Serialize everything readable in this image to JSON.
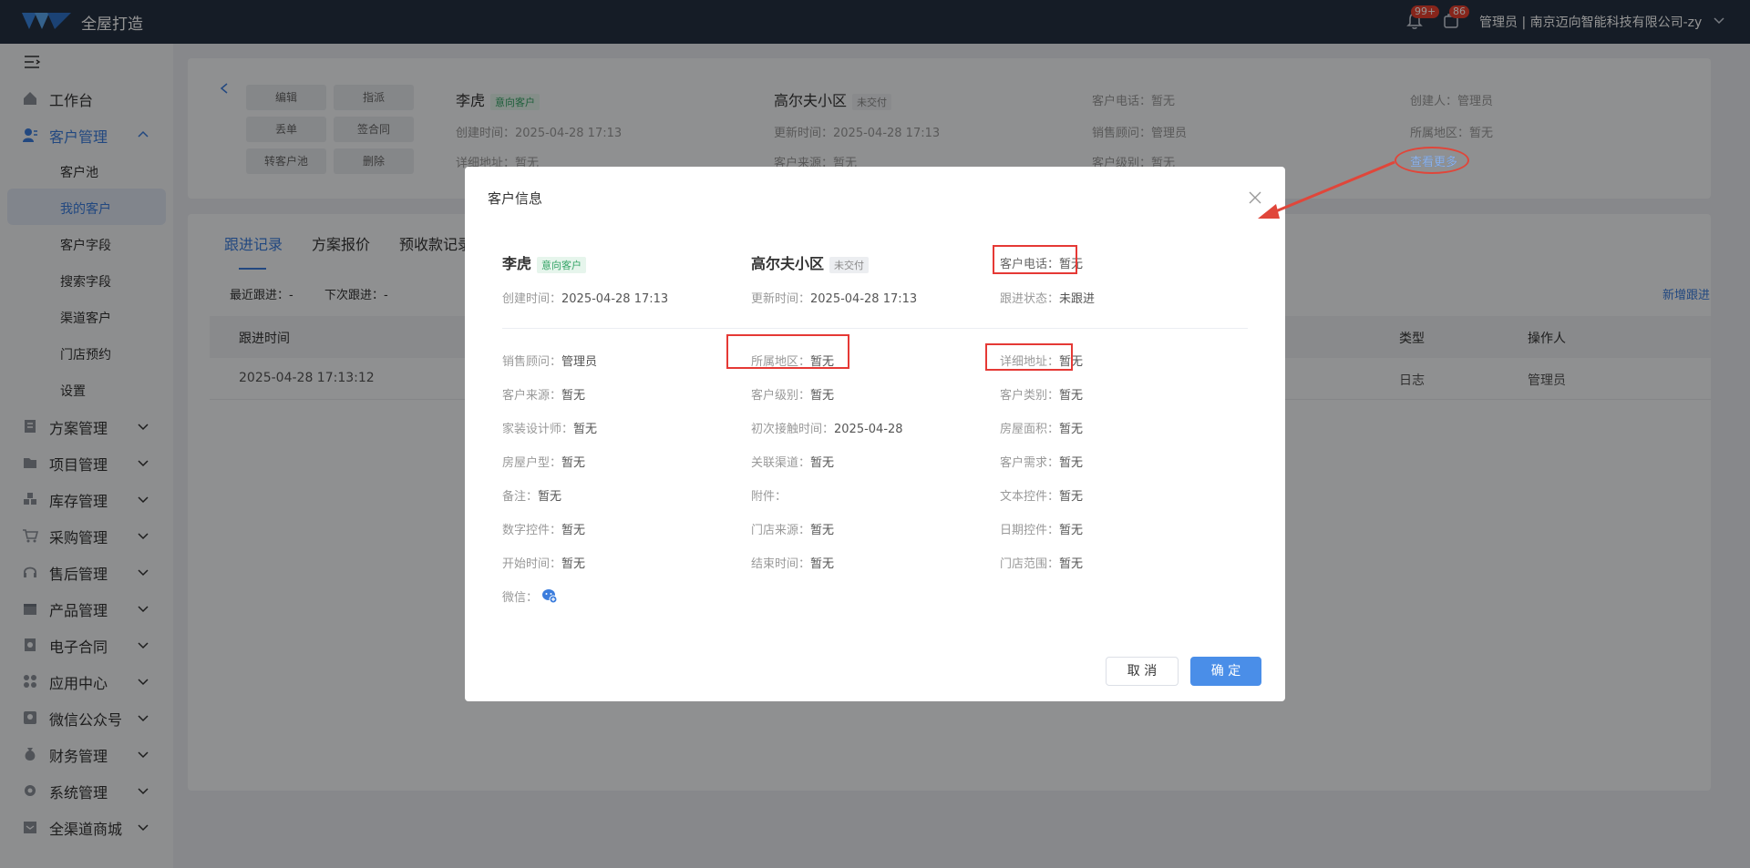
{
  "brand": "全屋打造",
  "header": {
    "notify_badge": "99+",
    "todo_badge": "86",
    "user": "管理员 | 南京迈向智能科技有限公司-zy"
  },
  "sidebar": {
    "items": [
      {
        "label": "工作台"
      },
      {
        "label": "客户管理"
      },
      {
        "label": "方案管理"
      },
      {
        "label": "项目管理"
      },
      {
        "label": "库存管理"
      },
      {
        "label": "采购管理"
      },
      {
        "label": "售后管理"
      },
      {
        "label": "产品管理"
      },
      {
        "label": "电子合同"
      },
      {
        "label": "应用中心"
      },
      {
        "label": "微信公众号"
      },
      {
        "label": "财务管理"
      },
      {
        "label": "系统管理"
      },
      {
        "label": "全渠道商城"
      }
    ],
    "sub_items": [
      {
        "label": "客户池"
      },
      {
        "label": "我的客户"
      },
      {
        "label": "客户字段"
      },
      {
        "label": "搜索字段"
      },
      {
        "label": "渠道客户"
      },
      {
        "label": "门店预约"
      },
      {
        "label": "设置"
      }
    ]
  },
  "customer_card": {
    "actions": [
      "编辑",
      "指派",
      "丢单",
      "签合同",
      "转客户池",
      "删除"
    ],
    "name": "李虎",
    "name_tag": "意向客户",
    "community": "高尔夫小区",
    "community_tag": "未交付",
    "created": "创建时间：2025-04-28 17:13",
    "updated": "更新时间：2025-04-28 17:13",
    "address": "详细地址：暂无",
    "source": "客户来源：暂无",
    "phone": "客户电话：暂无",
    "consultant": "销售顾问：管理员",
    "level": "客户级别：暂无",
    "creator": "创建人：管理员",
    "region": "所属地区：暂无",
    "more": "查看更多"
  },
  "tabs": [
    "跟进记录",
    "方案报价",
    "预收款记录"
  ],
  "follow": {
    "last": "最近跟进：-",
    "next": "下次跟进：-",
    "add": "新增跟进",
    "columns": {
      "time": "跟进时间",
      "type": "类型",
      "operator": "操作人"
    },
    "row": {
      "time": "2025-04-28 17:13:12",
      "type": "日志",
      "operator": "管理员"
    }
  },
  "modal": {
    "title": "客户信息",
    "name": "李虎",
    "name_tag": "意向客户",
    "community": "高尔夫小区",
    "community_tag": "未交付",
    "phone_label": "客户电话：",
    "phone_value": "暂无",
    "created_label": "创建时间：",
    "created_value": "2025-04-28 17:13",
    "updated_label": "更新时间：",
    "updated_value": "2025-04-28 17:13",
    "status_label": "跟进状态：",
    "status_value": "未跟进",
    "fields": [
      {
        "label": "销售顾问：",
        "value": "管理员"
      },
      {
        "label": "所属地区：",
        "value": "暂无"
      },
      {
        "label": "详细地址：",
        "value": "暂无"
      },
      {
        "label": "客户来源：",
        "value": "暂无"
      },
      {
        "label": "客户级别：",
        "value": "暂无"
      },
      {
        "label": "客户类别：",
        "value": "暂无"
      },
      {
        "label": "家装设计师：",
        "value": "暂无"
      },
      {
        "label": "初次接触时间：",
        "value": "2025-04-28"
      },
      {
        "label": "房屋面积：",
        "value": "暂无"
      },
      {
        "label": "房屋户型：",
        "value": "暂无"
      },
      {
        "label": "关联渠道：",
        "value": "暂无"
      },
      {
        "label": "客户需求：",
        "value": "暂无"
      },
      {
        "label": "备注：",
        "value": "暂无"
      },
      {
        "label": "附件：",
        "value": ""
      },
      {
        "label": "文本控件：",
        "value": "暂无"
      },
      {
        "label": "数字控件：",
        "value": "暂无"
      },
      {
        "label": "门店来源：",
        "value": "暂无"
      },
      {
        "label": "日期控件：",
        "value": "暂无"
      },
      {
        "label": "开始时间：",
        "value": "暂无"
      },
      {
        "label": "结束时间：",
        "value": "暂无"
      },
      {
        "label": "门店范围：",
        "value": "暂无"
      },
      {
        "label": "微信：",
        "value": ""
      }
    ],
    "cancel": "取 消",
    "ok": "确 定"
  },
  "colors": {
    "accent": "#3b7ddd",
    "highlight": "#e53935",
    "topbar": "#253142"
  }
}
